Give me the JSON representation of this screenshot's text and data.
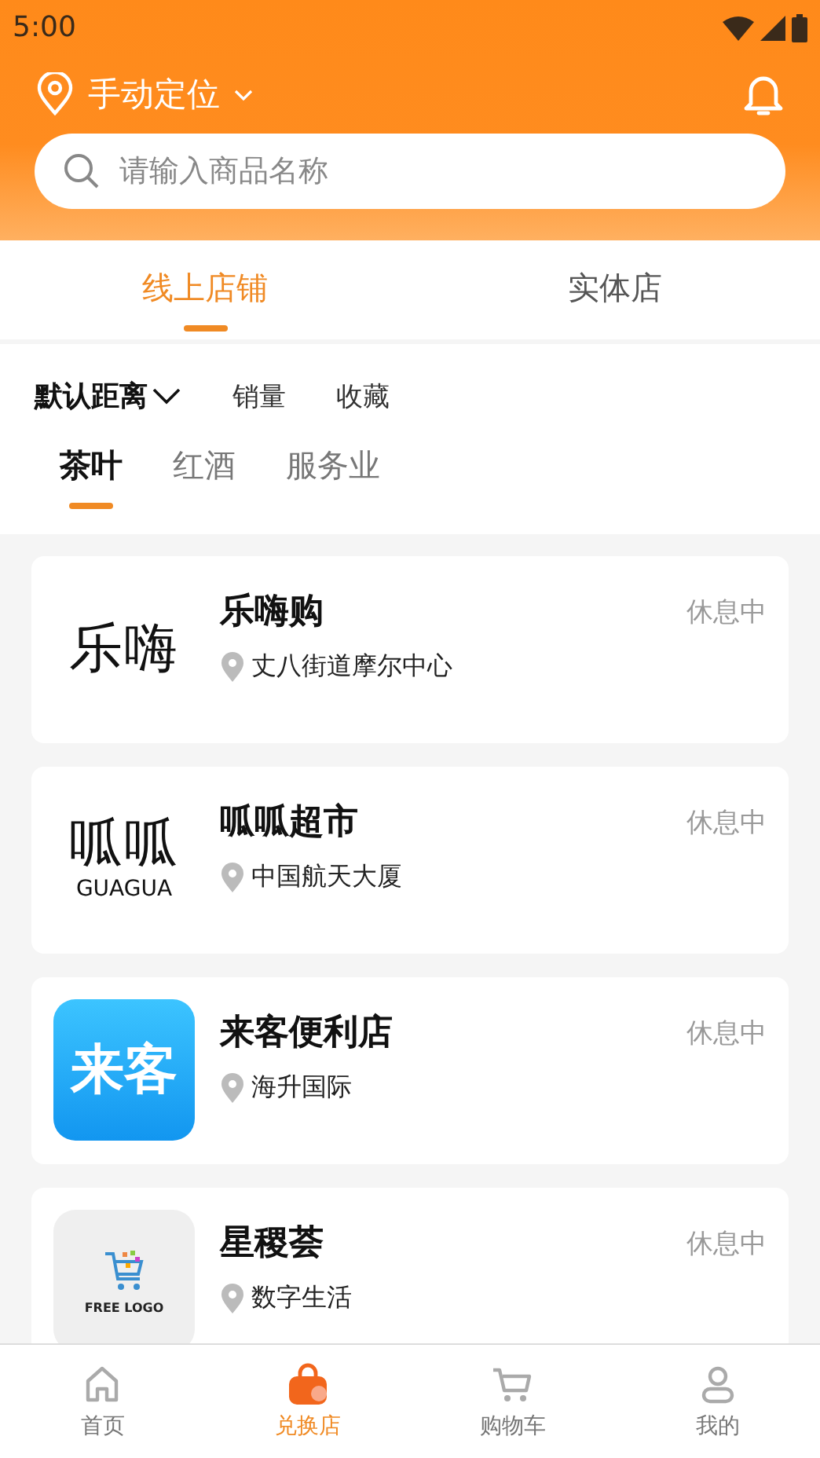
{
  "status_bar": {
    "time": "5:00"
  },
  "header": {
    "location": "手动定位",
    "search": {
      "placeholder": "请输入商品名称"
    }
  },
  "tabs": [
    {
      "label": "线上店铺",
      "selected": true
    },
    {
      "label": "实体店",
      "selected": false
    }
  ],
  "sort_options": [
    {
      "label": "默认距离",
      "selected": true,
      "dropdown": true
    },
    {
      "label": "销量",
      "selected": false,
      "dropdown": false
    },
    {
      "label": "收藏",
      "selected": false,
      "dropdown": false
    }
  ],
  "categories": [
    {
      "label": "茶叶",
      "selected": true
    },
    {
      "label": "红酒",
      "selected": false
    },
    {
      "label": "服务业",
      "selected": false
    }
  ],
  "stores": [
    {
      "name": "乐嗨购",
      "address": "丈八街道摩尔中心",
      "status": "休息中",
      "logo": {
        "kind": "wordmark",
        "text": "乐嗨"
      }
    },
    {
      "name": "呱呱超市",
      "address": "中国航天大厦",
      "status": "休息中",
      "logo": {
        "kind": "wordmark",
        "text": "呱呱",
        "subtext": "GUAGUA"
      }
    },
    {
      "name": "来客便利店",
      "address": "海升国际",
      "status": "休息中",
      "logo": {
        "kind": "tile",
        "text": "来客"
      }
    },
    {
      "name": "星稷荟",
      "address": "数字生活",
      "status": "休息中",
      "logo": {
        "kind": "cart",
        "text": "FREE LOGO"
      }
    }
  ],
  "bottom_nav": [
    {
      "label": "首页",
      "kind": "home",
      "selected": false
    },
    {
      "label": "兑换店",
      "kind": "bag",
      "selected": true
    },
    {
      "label": "购物车",
      "kind": "cart",
      "selected": false
    },
    {
      "label": "我的",
      "kind": "person",
      "selected": false
    }
  ]
}
